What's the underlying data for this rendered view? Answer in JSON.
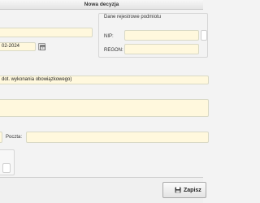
{
  "window": {
    "title": "Nowa decyzja"
  },
  "form": {
    "date_value": "02-2024",
    "obligation_field_value": "dot. wykonania obowiązkowego)",
    "post_label": "Poczta:"
  },
  "registry_group": {
    "title": "Dane rejestrowe podmiotu",
    "nip_label": "NIP:",
    "regon_label": "REGON:"
  },
  "footer": {
    "save_label": "Zapisz"
  },
  "colors": {
    "field_background": "#fff8dd",
    "title_bar": "#e4e4e4"
  },
  "icons": [
    "calendar-icon",
    "save-icon"
  ]
}
